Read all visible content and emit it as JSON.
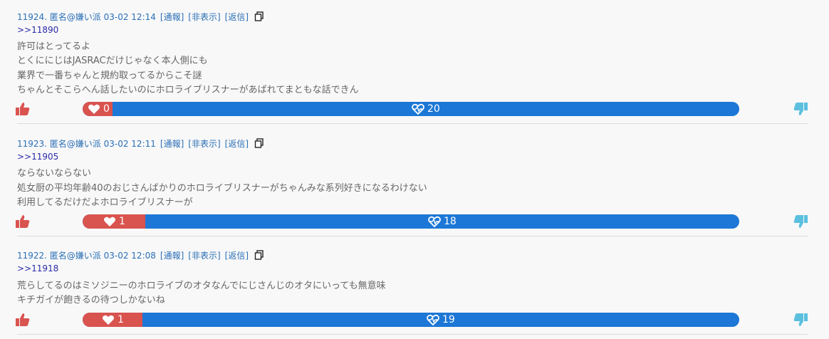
{
  "posts": [
    {
      "header": "11924. 匿名@嫌い派 03-02 12:14",
      "report": "[通報]",
      "hide": "[非表示]",
      "reply_link": "[返信]",
      "reply_to": ">>11890",
      "lines": [
        "許可はとってるよ",
        "とくににじはJASRACだけじゃなく本人側にも",
        "業界で一番ちゃんと規約取ってるからこそ謎",
        "ちゃんとそこらへん話したいのにホロライブリスナーがあばれてまともな話できん"
      ],
      "likes": "0",
      "dislikes": "20",
      "like_fraction": 0.0
    },
    {
      "header": "11923. 匿名@嫌い派 03-02 12:11",
      "report": "[通報]",
      "hide": "[非表示]",
      "reply_link": "[返信]",
      "reply_to": ">>11905",
      "lines": [
        "ならないならない",
        "処女厨の平均年齢40のおじさんばかりのホロライブリスナーがちゃんみな系列好きになるわけない",
        "利用してるだけだよホロライブリスナーが"
      ],
      "likes": "1",
      "dislikes": "18",
      "like_fraction": 0.0526
    },
    {
      "header": "11922. 匿名@嫌い派 03-02 12:08",
      "report": "[通報]",
      "hide": "[非表示]",
      "reply_link": "[返信]",
      "reply_to": ">>11918",
      "lines": [
        "荒らしてるのはミソジニーのホロライブのオタなんでにじさんじのオタにいっても無意味",
        "キチガイが飽きるの待つしかないね"
      ],
      "likes": "1",
      "dislikes": "19",
      "like_fraction": 0.05
    }
  ],
  "colors": {
    "like": "#d9534f",
    "dislike": "#1c77d6",
    "thumb_down": "#5bc0de",
    "link": "#2a6fb5"
  },
  "icons": {
    "like_button": "thumbs-up-icon",
    "dislike_button": "thumbs-down-icon",
    "like_bar": "heart-icon",
    "dislike_bar": "heart-pulse-icon",
    "copy": "copy-icon"
  }
}
